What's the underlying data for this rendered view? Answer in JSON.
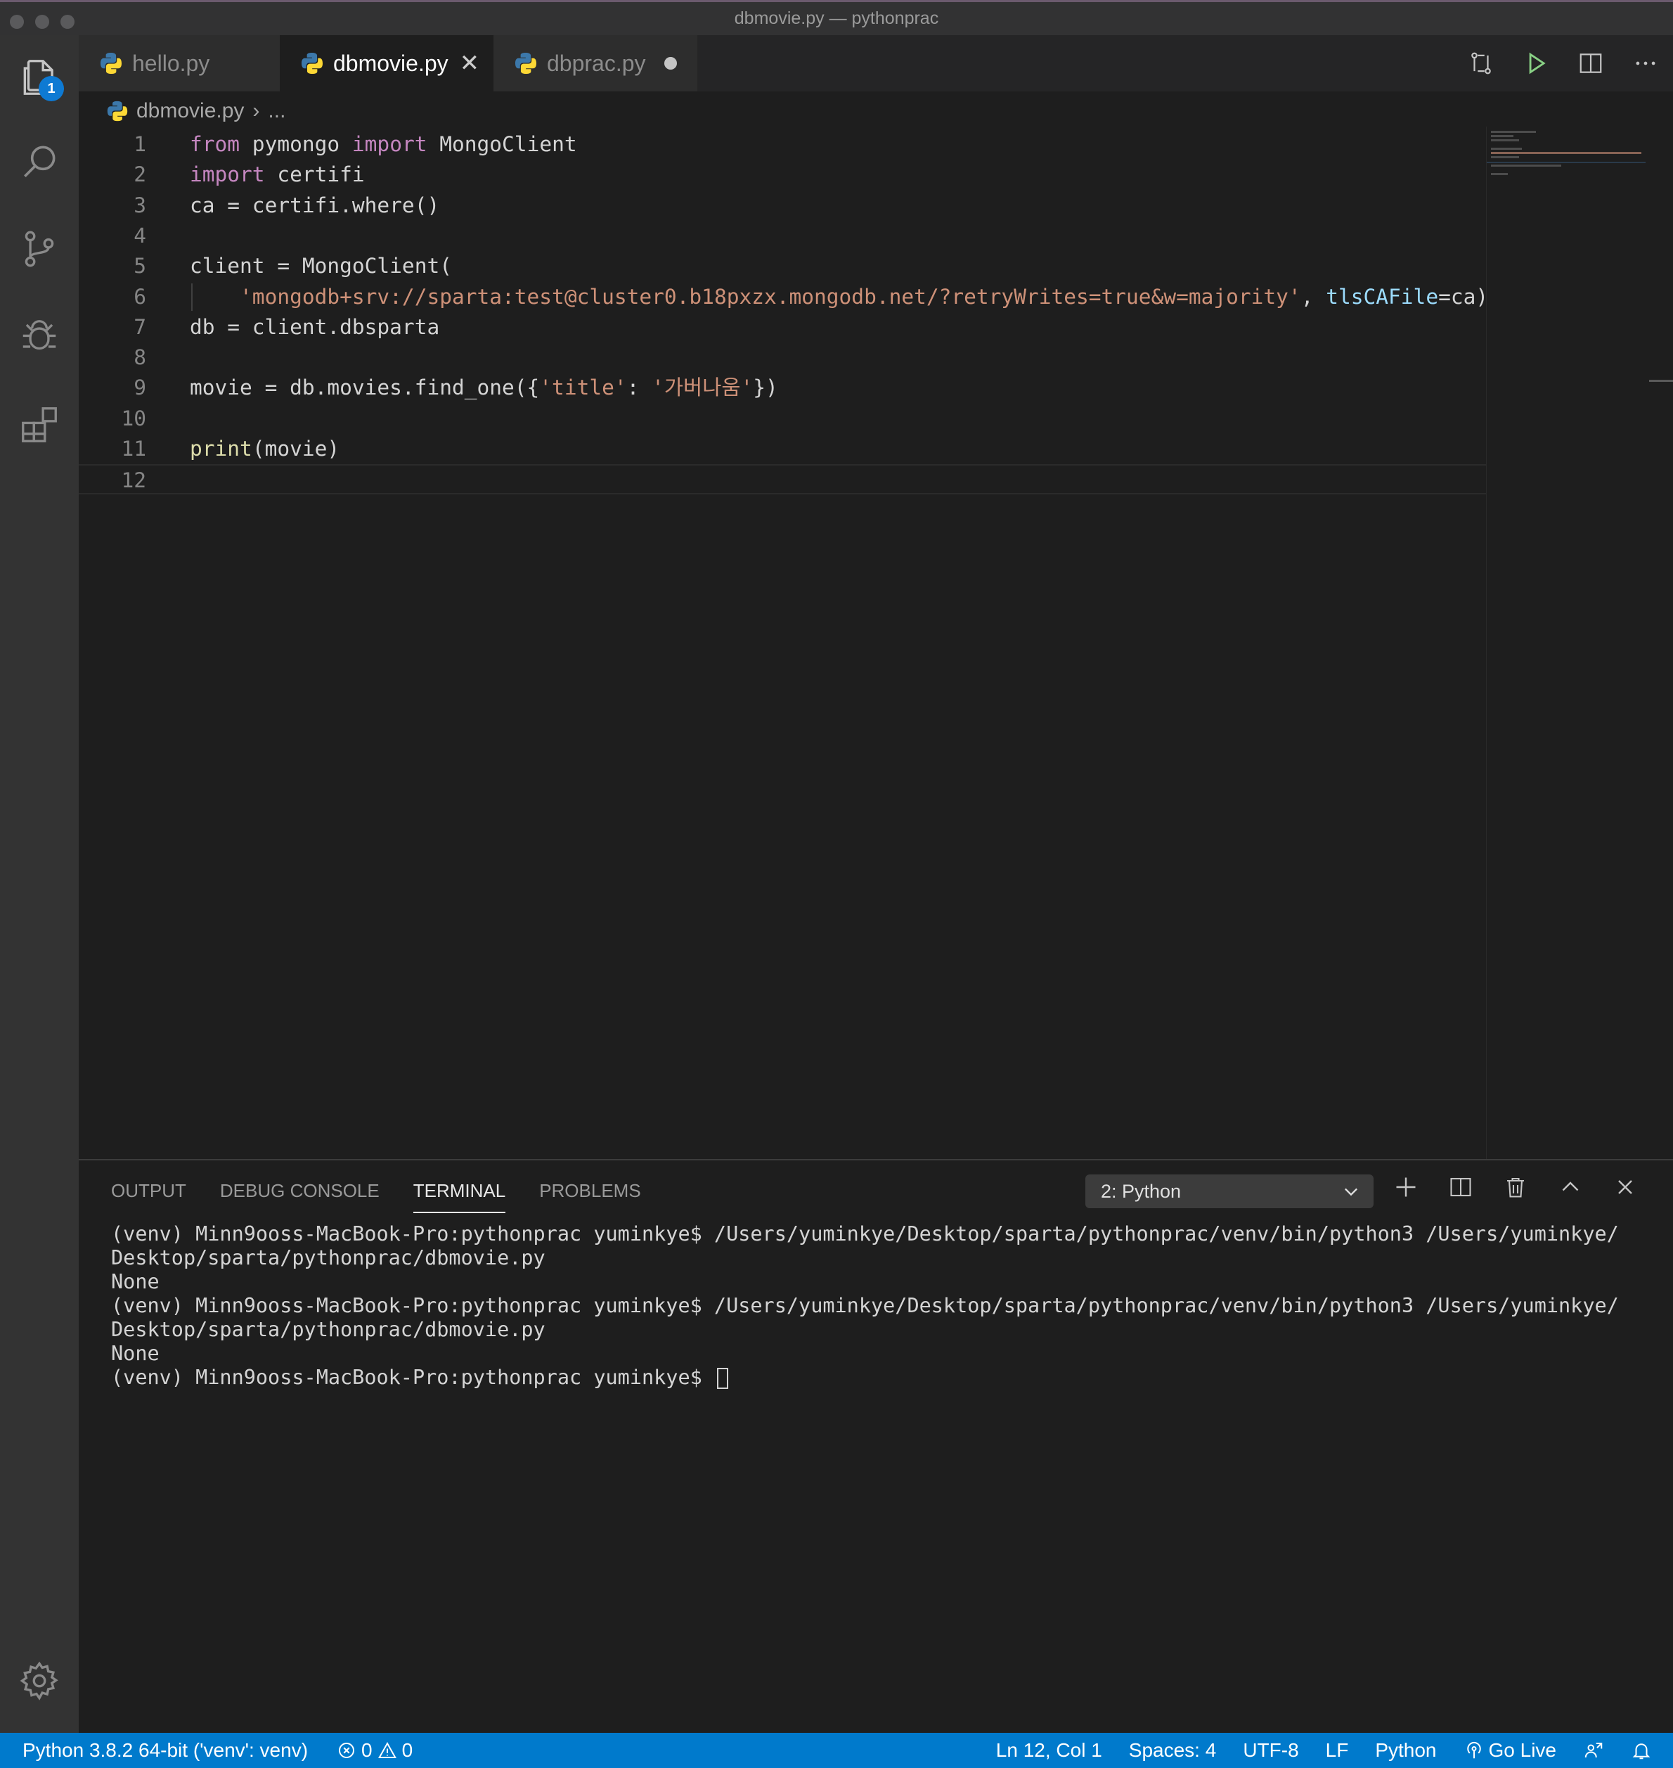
{
  "window": {
    "title": "dbmovie.py — pythonprac"
  },
  "activity": {
    "explorer_badge": "1"
  },
  "tabs": [
    {
      "label": "hello.py",
      "state": "inactive"
    },
    {
      "label": "dbmovie.py",
      "state": "active",
      "close": "✕"
    },
    {
      "label": "dbprac.py",
      "state": "modified"
    }
  ],
  "breadcrumb": {
    "file": "dbmovie.py",
    "separator": "›",
    "rest": "..."
  },
  "editor": {
    "line_numbers": [
      "1",
      "2",
      "3",
      "4",
      "5",
      "6",
      "7",
      "8",
      "9",
      "10",
      "11",
      "12"
    ],
    "lines": [
      [
        {
          "t": "from",
          "c": "kw"
        },
        {
          "t": " pymongo ",
          "c": ""
        },
        {
          "t": "import",
          "c": "kw"
        },
        {
          "t": " MongoClient",
          "c": ""
        }
      ],
      [
        {
          "t": "import",
          "c": "kw"
        },
        {
          "t": " certifi",
          "c": ""
        }
      ],
      [
        {
          "t": "ca = certifi.where()",
          "c": ""
        }
      ],
      [],
      [
        {
          "t": "client = MongoClient(",
          "c": ""
        }
      ],
      [
        {
          "t": "    ",
          "c": ""
        },
        {
          "t": "'mongodb+srv://sparta:test@cluster0.b18pxzx.mongodb.net/?retryWrites=true&w=majority'",
          "c": "str"
        },
        {
          "t": ", ",
          "c": ""
        },
        {
          "t": "tlsCAFile",
          "c": "param"
        },
        {
          "t": "=ca)",
          "c": ""
        }
      ],
      [
        {
          "t": "db = client.dbsparta",
          "c": ""
        }
      ],
      [],
      [
        {
          "t": "movie = db.movies.find_one({",
          "c": ""
        },
        {
          "t": "'title'",
          "c": "str"
        },
        {
          "t": ": ",
          "c": ""
        },
        {
          "t": "'가버나움'",
          "c": "str"
        },
        {
          "t": "})",
          "c": ""
        }
      ],
      [],
      [
        {
          "t": "print",
          "c": "fn"
        },
        {
          "t": "(movie)",
          "c": ""
        }
      ],
      []
    ],
    "current_line": 12
  },
  "panel": {
    "tabs": [
      "OUTPUT",
      "DEBUG CONSOLE",
      "TERMINAL",
      "PROBLEMS"
    ],
    "active_tab": "TERMINAL",
    "terminal_select": "2: Python",
    "terminal_lines": [
      "(venv) Minn9ooss-MacBook-Pro:pythonprac yuminkye$ /Users/yuminkye/Desktop/sparta/pythonprac/venv/bin/python3 /Users/yuminkye/",
      "Desktop/sparta/pythonprac/dbmovie.py",
      "None",
      "(venv) Minn9ooss-MacBook-Pro:pythonprac yuminkye$ /Users/yuminkye/Desktop/sparta/pythonprac/venv/bin/python3 /Users/yuminkye/",
      "Desktop/sparta/pythonprac/dbmovie.py",
      "None",
      "(venv) Minn9ooss-MacBook-Pro:pythonprac yuminkye$ "
    ]
  },
  "statusbar": {
    "interpreter": "Python 3.8.2 64-bit ('venv': venv)",
    "errors": "0",
    "warnings": "0",
    "position": "Ln 12, Col 1",
    "spaces": "Spaces: 4",
    "encoding": "UTF-8",
    "eol": "LF",
    "language": "Python",
    "golive": "Go Live"
  },
  "colors": {
    "keyword": "#c586c0",
    "string": "#ce9178",
    "function": "#dcdcaa",
    "parameter": "#9cdcfe",
    "statusbar": "#007acc",
    "badge": "#0e7ad3",
    "run": "#89d185"
  }
}
